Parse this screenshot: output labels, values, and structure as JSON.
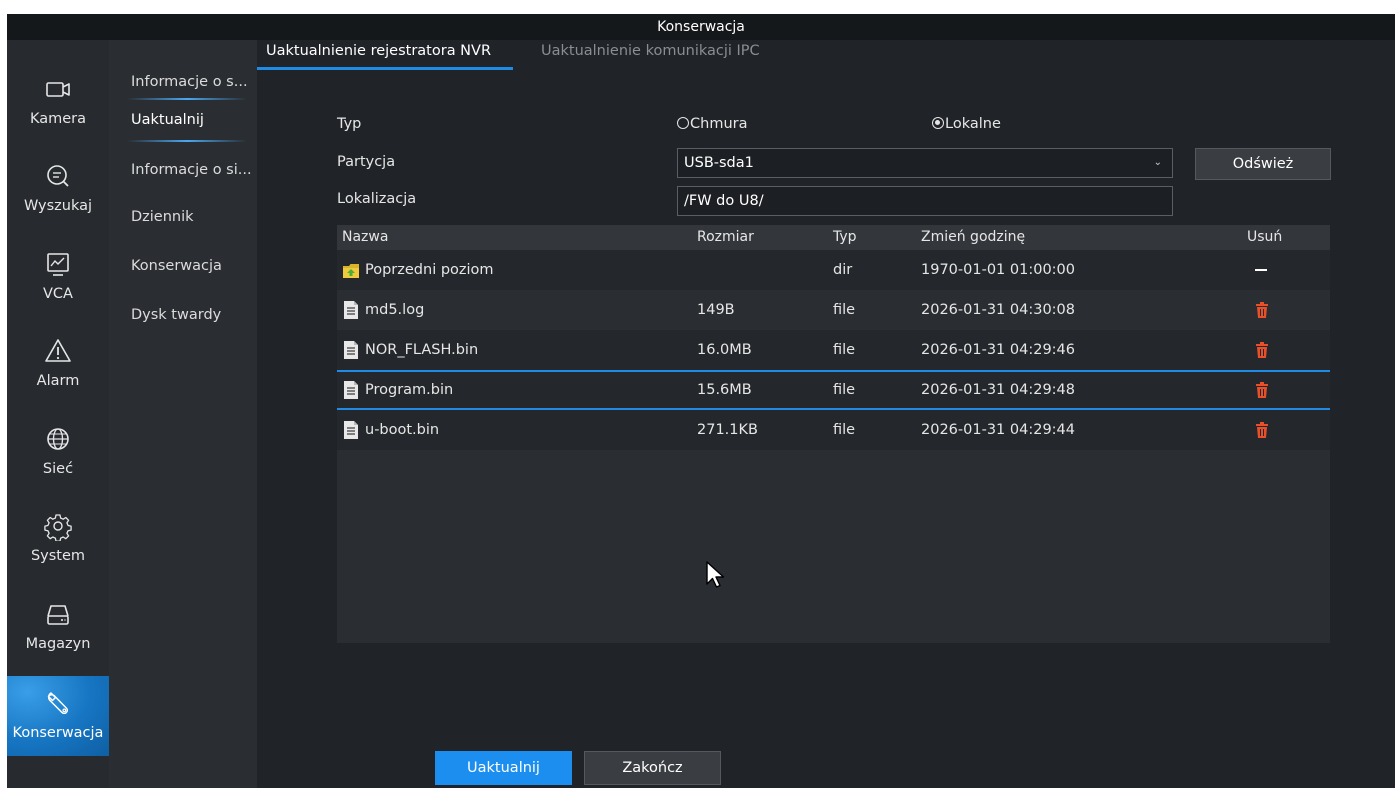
{
  "window": {
    "title": "Konserwacja"
  },
  "nav": {
    "items": [
      {
        "label": "Kamera",
        "icon": "camera-icon"
      },
      {
        "label": "Wyszukaj",
        "icon": "search-icon"
      },
      {
        "label": "VCA",
        "icon": "vca-icon"
      },
      {
        "label": "Alarm",
        "icon": "alarm-icon"
      },
      {
        "label": "Sieć",
        "icon": "globe-icon"
      },
      {
        "label": "System",
        "icon": "gear-icon"
      },
      {
        "label": "Magazyn",
        "icon": "storage-icon"
      },
      {
        "label": "Konserwacja",
        "icon": "wrench-icon",
        "active": true
      }
    ]
  },
  "subnav": {
    "items": [
      {
        "label": "Informacje o s..."
      },
      {
        "label": "Uaktualnij",
        "active": true
      },
      {
        "label": "Informacje o si..."
      },
      {
        "label": "Dziennik"
      },
      {
        "label": "Konserwacja"
      },
      {
        "label": "Dysk twardy"
      }
    ]
  },
  "tabs": {
    "active": "Uaktualnienie rejestratora NVR",
    "inactive": "Uaktualnienie komunikacji IPC"
  },
  "form": {
    "type_label": "Typ",
    "type_options": [
      "Chmura",
      "Lokalne"
    ],
    "type_selected": "Lokalne",
    "partition_label": "Partycja",
    "partition_value": "USB-sda1",
    "refresh_label": "Odśwież",
    "location_label": "Lokalizacja",
    "location_value": "/FW do U8/"
  },
  "table": {
    "columns": [
      "Nazwa",
      "Rozmiar",
      "Typ",
      "Zmień godzinę",
      "Usuń"
    ],
    "rows": [
      {
        "name": "Poprzedni poziom",
        "size": "",
        "type": "dir",
        "time": "1970-01-01 01:00:00",
        "icon": "folder-up-icon",
        "delete": "dash"
      },
      {
        "name": "md5.log",
        "size": "149B",
        "type": "file",
        "time": "2026-01-31 04:30:08",
        "icon": "file-icon",
        "delete": "trash"
      },
      {
        "name": "NOR_FLASH.bin",
        "size": "16.0MB",
        "type": "file",
        "time": "2026-01-31 04:29:46",
        "icon": "file-icon",
        "delete": "trash"
      },
      {
        "name": "Program.bin",
        "size": "15.6MB",
        "type": "file",
        "time": "2026-01-31 04:29:48",
        "icon": "file-icon",
        "delete": "trash",
        "selected": true
      },
      {
        "name": "u-boot.bin",
        "size": "271.1KB",
        "type": "file",
        "time": "2026-01-31 04:29:44",
        "icon": "file-icon",
        "delete": "trash"
      }
    ]
  },
  "buttons": {
    "upgrade": "Uaktualnij",
    "exit": "Zakończ"
  },
  "colors": {
    "accent": "#1f8be5",
    "delete": "#e8502a",
    "background": "#202328"
  }
}
